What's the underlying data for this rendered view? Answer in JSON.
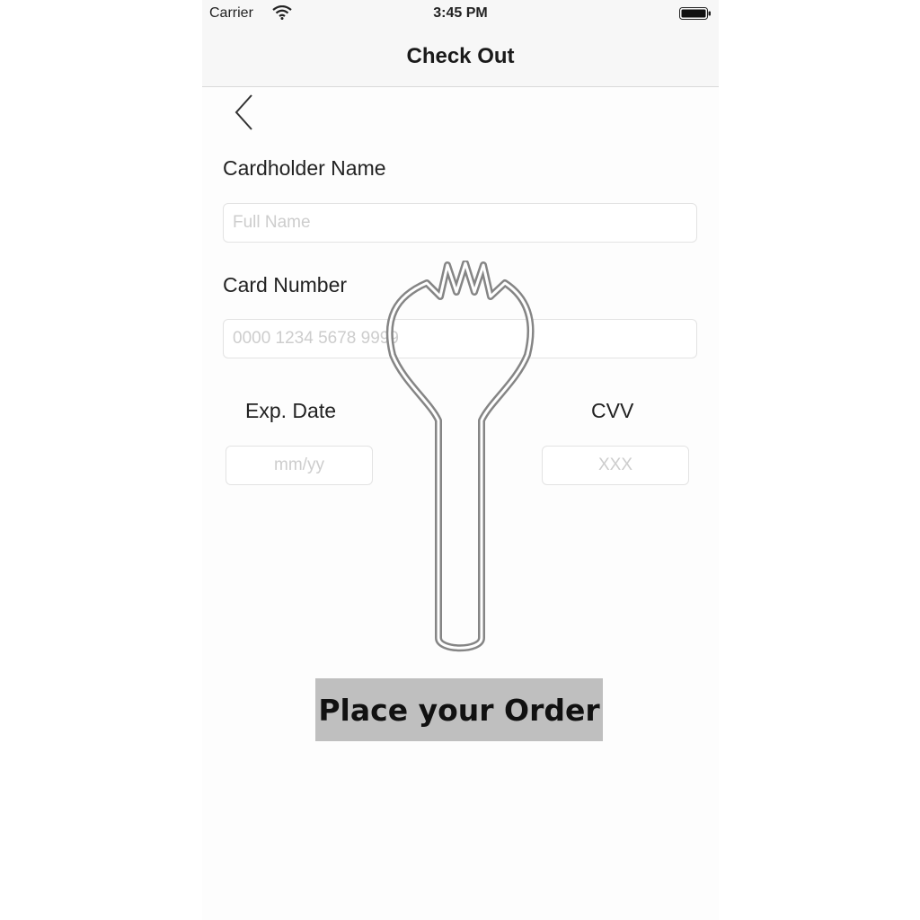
{
  "status_bar": {
    "carrier": "Carrier",
    "time": "3:45 PM"
  },
  "nav": {
    "title": "Check Out"
  },
  "form": {
    "cardholder_label": "Cardholder Name",
    "cardholder_placeholder": "Full Name",
    "card_number_label": "Card Number",
    "card_number_placeholder": "0000 1234 5678 9999",
    "exp_label": "Exp. Date",
    "exp_placeholder": "mm/yy",
    "cvv_label": "CVV",
    "cvv_placeholder": "XXX"
  },
  "order_button": {
    "label": "Place your Order"
  },
  "icons": {
    "back": "chevron-left-icon",
    "wifi": "wifi-icon",
    "battery": "battery-icon",
    "watermark": "spork-icon"
  },
  "colors": {
    "button_bg": "#bfbfbf",
    "bar_bg": "#f7f7f7",
    "placeholder": "#cdcdcd"
  }
}
